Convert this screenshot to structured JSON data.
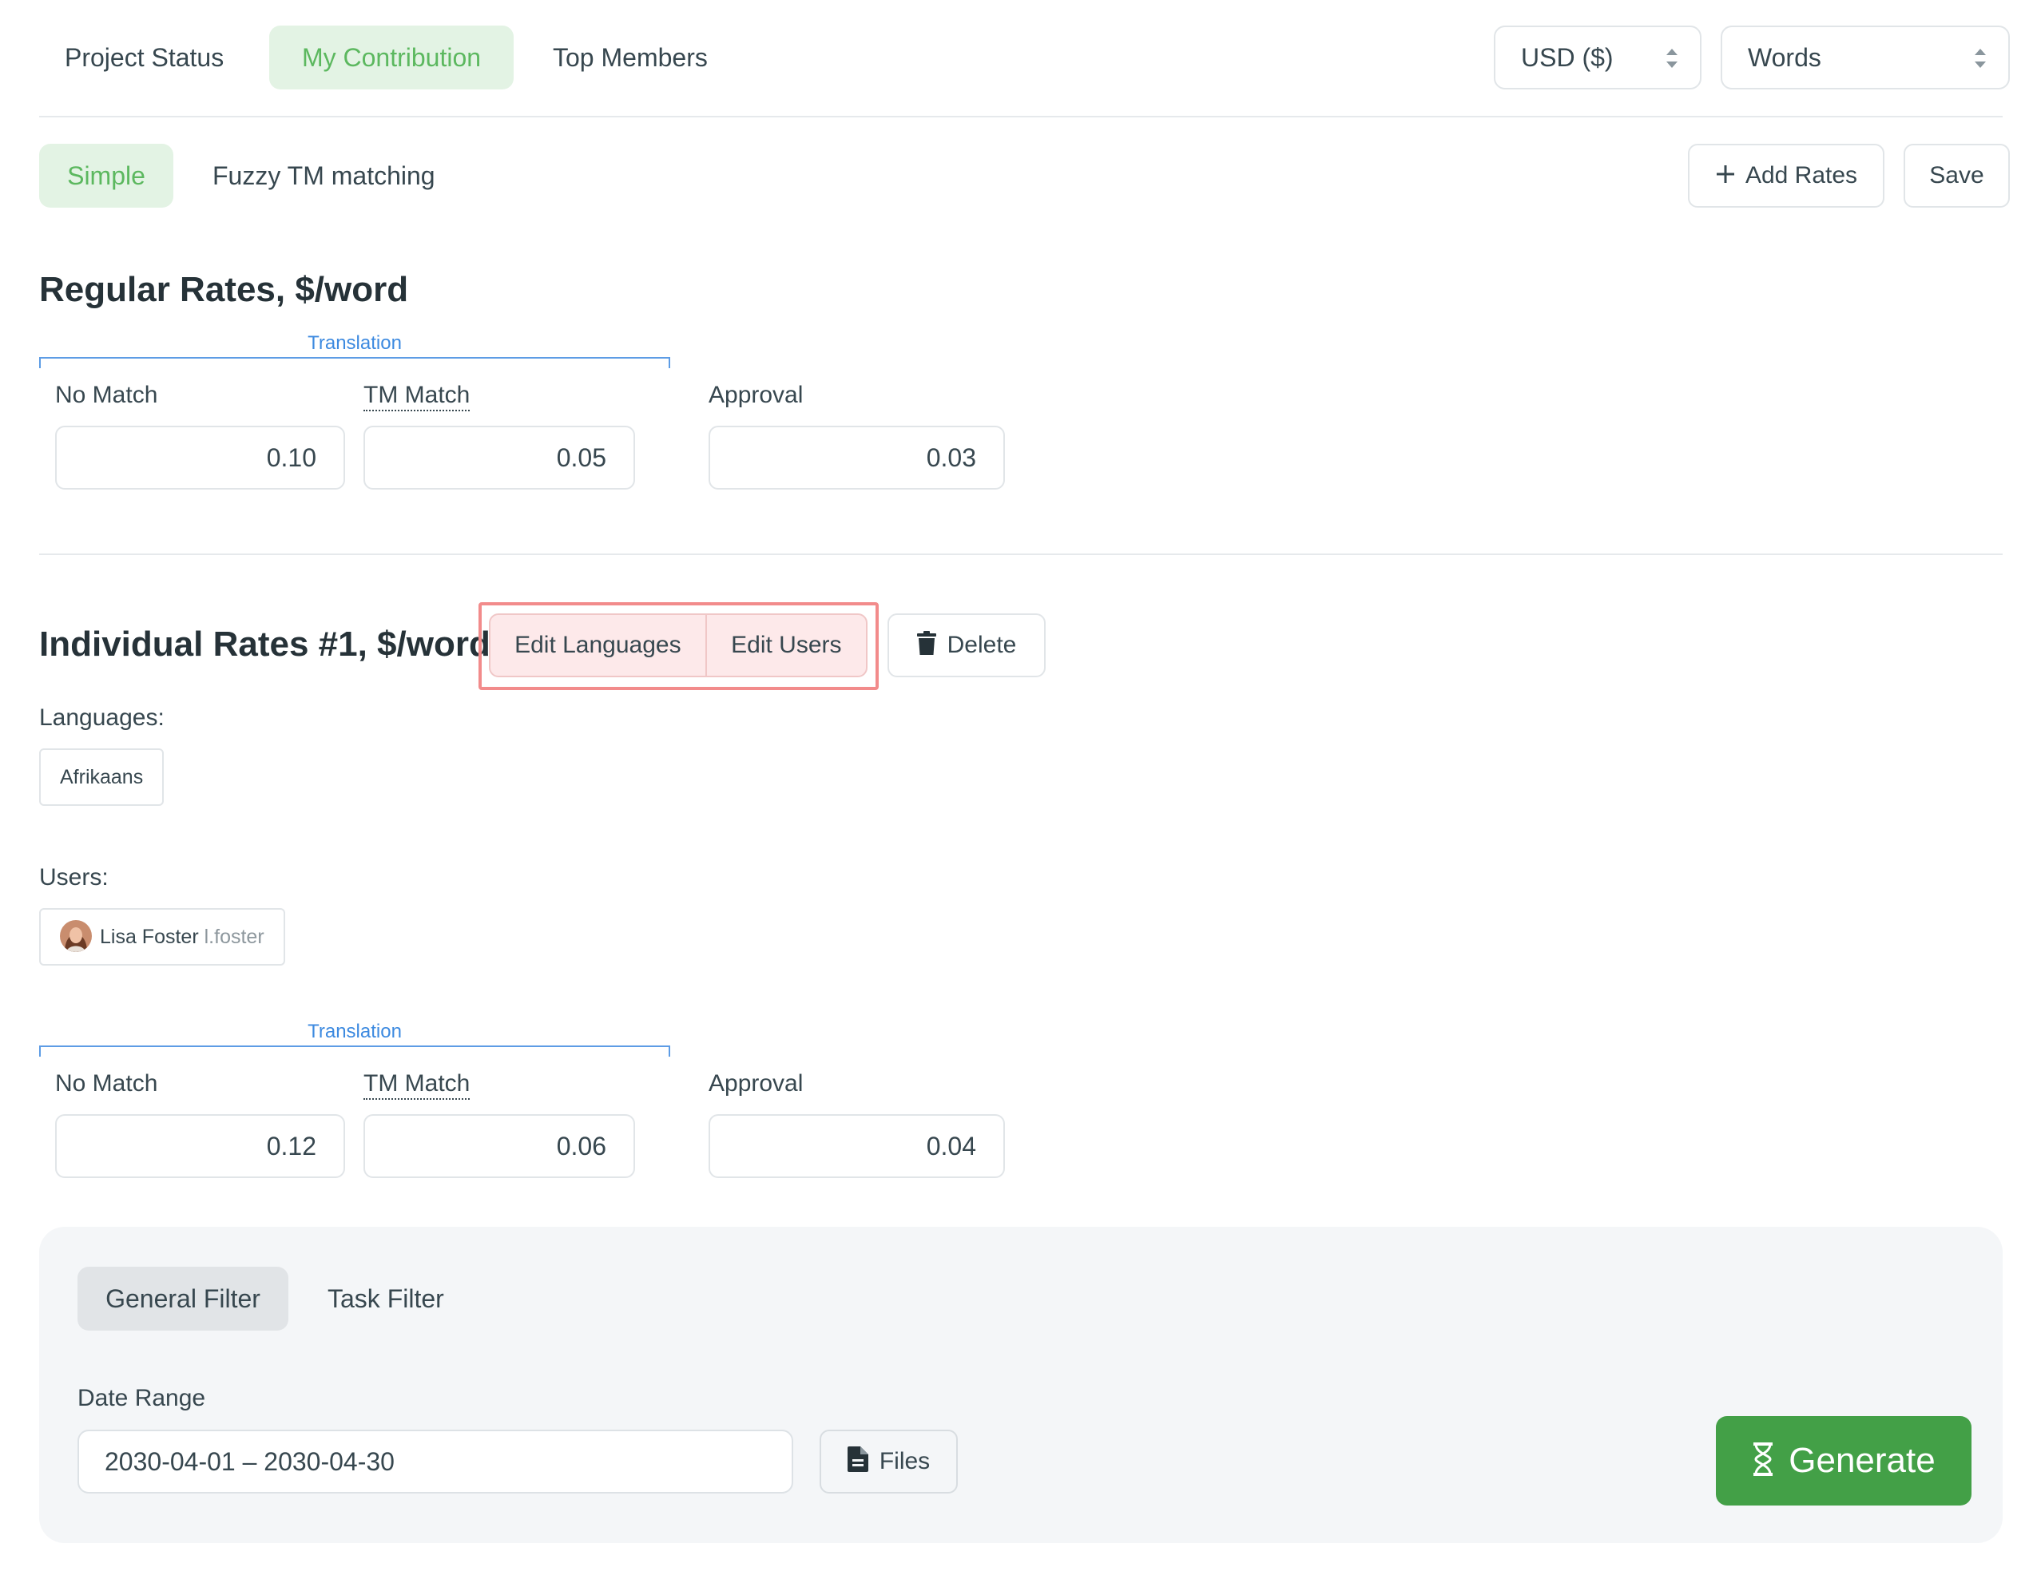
{
  "top_tabs": [
    {
      "label": "Project Status",
      "active": false
    },
    {
      "label": "My Contribution",
      "active": true
    },
    {
      "label": "Top Members",
      "active": false
    }
  ],
  "currency_select": {
    "value": "USD ($)"
  },
  "unit_select": {
    "value": "Words"
  },
  "mode_tabs": [
    {
      "label": "Simple",
      "active": true
    },
    {
      "label": "Fuzzy TM matching",
      "active": false
    }
  ],
  "actions": {
    "add_rates": "Add Rates",
    "save": "Save"
  },
  "regular": {
    "title": "Regular Rates, $/word",
    "group_label": "Translation",
    "no_match_label": "No Match",
    "no_match_value": "0.10",
    "tm_match_label": "TM Match",
    "tm_match_value": "0.05",
    "approval_label": "Approval",
    "approval_value": "0.03"
  },
  "individual": {
    "title": "Individual Rates #1, $/word",
    "edit_languages": "Edit Languages",
    "edit_users": "Edit Users",
    "delete": "Delete",
    "languages_label": "Languages:",
    "languages": [
      "Afrikaans"
    ],
    "users_label": "Users:",
    "user": {
      "name": "Lisa Foster",
      "username": "l.foster"
    },
    "group_label": "Translation",
    "no_match_label": "No Match",
    "no_match_value": "0.12",
    "tm_match_label": "TM Match",
    "tm_match_value": "0.06",
    "approval_label": "Approval",
    "approval_value": "0.04"
  },
  "filter": {
    "tabs": [
      {
        "label": "General Filter",
        "active": true
      },
      {
        "label": "Task Filter",
        "active": false
      }
    ],
    "date_range_label": "Date Range",
    "date_range_value": "2030-04-01 – 2030-04-30",
    "files_button": "Files",
    "generate_button": "Generate"
  },
  "colors": {
    "accent_green": "#43a047",
    "active_tab_bg": "#e3f3e4",
    "active_tab_text": "#5cb85f",
    "highlight_border": "#f28b8b",
    "highlight_bg": "#fde9ea",
    "link_blue": "#3d8ae0"
  }
}
